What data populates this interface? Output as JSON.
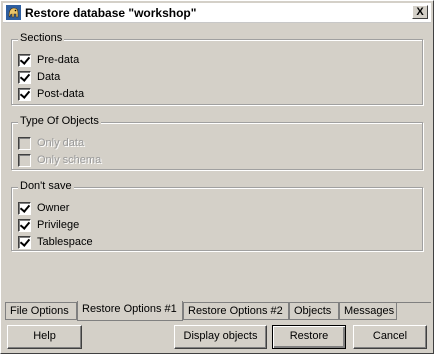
{
  "window": {
    "title": "Restore database \"workshop\"",
    "close_label": "X"
  },
  "sections": {
    "legend": "Sections",
    "items": [
      {
        "label": "Pre-data",
        "checked": true
      },
      {
        "label": "Data",
        "checked": true
      },
      {
        "label": "Post-data",
        "checked": true
      }
    ]
  },
  "object_types": {
    "legend": "Type Of Objects",
    "items": [
      {
        "label": "Only data",
        "checked": false,
        "disabled": true
      },
      {
        "label": "Only schema",
        "checked": false,
        "disabled": true
      }
    ]
  },
  "dont_save": {
    "legend": "Don't save",
    "items": [
      {
        "label": "Owner",
        "checked": true
      },
      {
        "label": "Privilege",
        "checked": true
      },
      {
        "label": "Tablespace",
        "checked": true
      }
    ]
  },
  "tabs": [
    {
      "label": "File Options",
      "active": false
    },
    {
      "label": "Restore Options #1",
      "active": true
    },
    {
      "label": "Restore Options #2",
      "active": false
    },
    {
      "label": "Objects",
      "active": false
    },
    {
      "label": "Messages",
      "active": false
    }
  ],
  "buttons": {
    "help": "Help",
    "display_objects": "Display objects",
    "restore": "Restore",
    "cancel": "Cancel"
  }
}
